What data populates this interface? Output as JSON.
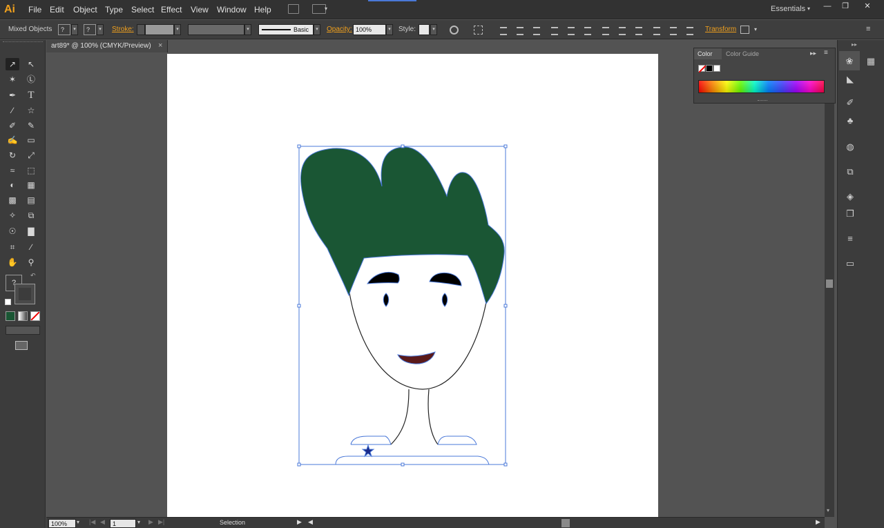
{
  "app": {
    "logo": "Ai"
  },
  "menubar": {
    "items": [
      "File",
      "Edit",
      "Object",
      "Type",
      "Select",
      "Effect",
      "View",
      "Window",
      "Help"
    ],
    "workspace": "Essentials",
    "workspace_arrow": "▾",
    "window_controls": [
      "—",
      "❐",
      "✕"
    ]
  },
  "controlbar": {
    "selection_label": "Mixed Objects",
    "fill_value": "?",
    "stroke_value": "?",
    "stroke_label": "Stroke:",
    "brush_label": "Basic",
    "opacity_label": "Opacity:",
    "opacity_value": "100%",
    "style_label": "Style:",
    "transform_label": "Transform",
    "drop_arrow": "▾"
  },
  "document": {
    "tab_title": "art89* @ 100% (CMYK/Preview)",
    "close_glyph": "×"
  },
  "color_panel": {
    "tabs": [
      "Color",
      "Color Guide"
    ],
    "expand_glyph": "▸▸",
    "menu_glyph": "≡"
  },
  "statusbar": {
    "zoom": "100%",
    "artboard_number": "1",
    "tool_name": "Selection"
  },
  "tools": [
    "selection-icon",
    "direct-selection-icon",
    "magic-wand-icon",
    "lasso-icon",
    "pen-icon",
    "type-icon",
    "line-icon",
    "star-icon",
    "paintbrush-icon",
    "pencil-icon",
    "blob-brush-icon",
    "eraser-icon",
    "rotate-icon",
    "scale-icon",
    "width-icon",
    "free-transform-icon",
    "shape-builder-icon",
    "perspective-grid-icon",
    "mesh-icon",
    "gradient-icon",
    "eyedropper-icon",
    "blend-icon",
    "symbol-sprayer-icon",
    "column-graph-icon",
    "artboard-icon",
    "slice-icon",
    "hand-icon",
    "zoom-icon"
  ],
  "artwork_colors": {
    "hair": "#1a5634",
    "mouth": "#5a1a1a",
    "selection": "#4a78d8"
  }
}
